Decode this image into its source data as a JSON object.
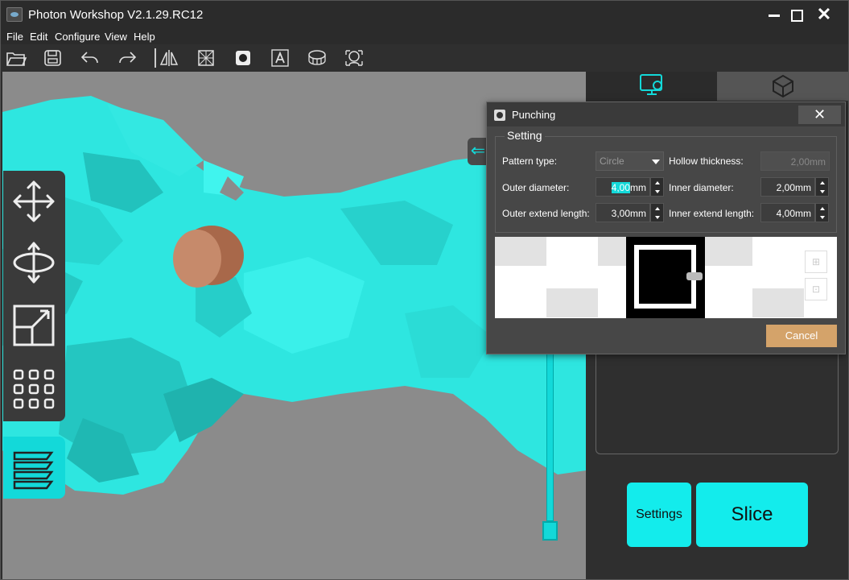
{
  "window": {
    "title": "Photon Workshop V2.1.29.RC12",
    "close_glyph": "✕"
  },
  "menu": [
    "File",
    "Edit",
    "Configure",
    "View",
    "Help"
  ],
  "toolbar_icons": [
    "open-folder-icon",
    "save-icon",
    "undo-icon",
    "redo-icon",
    "mirror-icon",
    "hollow-icon",
    "punching-icon",
    "text-icon",
    "support-icon",
    "repair-icon"
  ],
  "left_tools": [
    "move-icon",
    "rotate-icon",
    "scale-icon",
    "arrange-icon"
  ],
  "right_panel": {
    "settings_label": "Settings",
    "slice_label": "Slice"
  },
  "viewport": {
    "arrow_glyph": "⇐"
  },
  "dialog": {
    "title": "Punching",
    "close_glyph": "✕",
    "group_title": "Setting",
    "pattern_type_label": "Pattern type:",
    "pattern_type_value": "Circle",
    "hollow_thickness_label": "Hollow thickness:",
    "hollow_thickness_value": "2,00mm",
    "outer_diameter_label": "Outer diameter:",
    "outer_diameter_selected": "4,00",
    "outer_diameter_unit": "mm",
    "inner_diameter_label": "Inner diameter:",
    "inner_diameter_value": "2,00mm",
    "outer_extend_label": "Outer extend length:",
    "outer_extend_value": "3,00mm",
    "inner_extend_label": "Inner extend length:",
    "inner_extend_value": "4,00mm",
    "cancel_label": "Cancel"
  },
  "colors": {
    "accent": "#13ecec",
    "model": "#2ee6e0",
    "cancel": "#d4a36a",
    "hole": "#b87a5e"
  }
}
